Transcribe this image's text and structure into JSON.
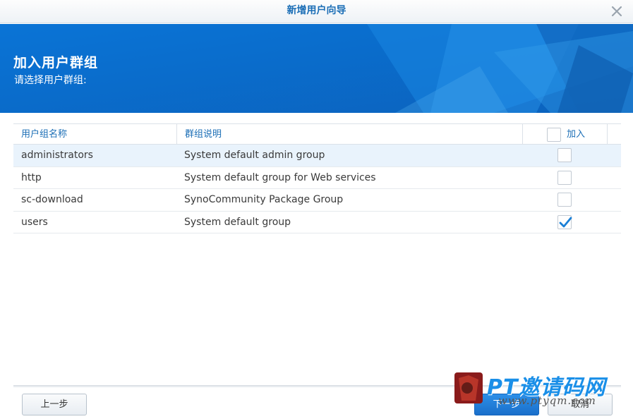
{
  "window": {
    "title": "新增用户向导"
  },
  "banner": {
    "heading": "加入用户群组",
    "subheading": "请选择用户群组:"
  },
  "grid": {
    "columns": {
      "name": "用户组名称",
      "description": "群组说明",
      "join": "加入"
    },
    "rows": [
      {
        "name": "administrators",
        "description": "System default admin group",
        "joined": false,
        "selected": true
      },
      {
        "name": "http",
        "description": "System default group for Web services",
        "joined": false,
        "selected": false
      },
      {
        "name": "sc-download",
        "description": "SynoCommunity Package Group",
        "joined": false,
        "selected": false
      },
      {
        "name": "users",
        "description": "System default group",
        "joined": true,
        "selected": false
      }
    ]
  },
  "footer": {
    "prev_label": "上一步",
    "next_label": "下一步",
    "cancel_label": "取消"
  },
  "watermark": {
    "text": "PT邀请码网",
    "url": "www.ptyqm.com"
  },
  "colors": {
    "accent": "#1b6eb6",
    "banner": "#0a6fcf",
    "check": "#1a7fd6"
  },
  "icons": {
    "close": "close-icon",
    "check": "checkmark-icon"
  }
}
